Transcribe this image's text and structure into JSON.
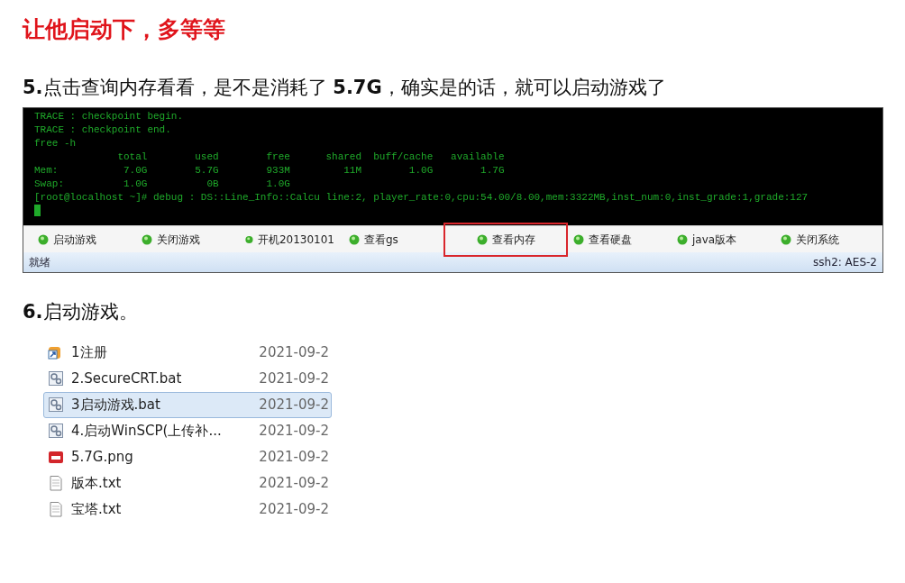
{
  "heading": "让他启动下，多等等",
  "step5": "**5.**点击查询内存看看，是不是消耗了 **5.7G**，确实是的话，就可以启动游戏了",
  "terminal": {
    "lines": [
      "TRACE : checkpoint begin.",
      "TRACE : checkpoint end.",
      "free -h",
      "              total        used        free      shared  buff/cache   available",
      "Mem:           7.0G        5.7G        933M         11M        1.0G        1.7G",
      "Swap:          1.0G          0B        1.0G",
      "[root@localhost ~]# debug : DS::Line_Info::Calcu line:2, player_rate:0,cpu:54.00/8.00,mem:3322MB,inst_num:0,inst_grade:1,grade:127"
    ],
    "buttons": [
      {
        "label": "启动游戏",
        "marked": false
      },
      {
        "label": "关闭游戏",
        "marked": false
      },
      {
        "label": "开机20130101",
        "marked": false
      },
      {
        "label": "查看gs",
        "marked": false
      },
      {
        "label": "查看内存",
        "marked": true
      },
      {
        "label": "查看硬盘",
        "marked": false
      },
      {
        "label": "java版本",
        "marked": false
      },
      {
        "label": "关闭系统",
        "marked": false
      }
    ],
    "status_left": "就绪",
    "status_right": "ssh2: AES-2"
  },
  "step6": "**6.**启动游戏。",
  "files": [
    {
      "kind": "shortcut",
      "name": "1注册",
      "date": "2021-09-2",
      "selected": false
    },
    {
      "kind": "bat",
      "name": "2.SecureCRT.bat",
      "date": "2021-09-2",
      "selected": false
    },
    {
      "kind": "bat",
      "name": "3启动游戏.bat",
      "date": "2021-09-2",
      "selected": true
    },
    {
      "kind": "bat",
      "name": "4.启动WinSCP(上传补...",
      "date": "2021-09-2",
      "selected": false
    },
    {
      "kind": "png",
      "name": "5.7G.png",
      "date": "2021-09-2",
      "selected": false
    },
    {
      "kind": "txt",
      "name": "版本.txt",
      "date": "2021-09-2",
      "selected": false
    },
    {
      "kind": "txt",
      "name": "宝塔.txt",
      "date": "2021-09-2",
      "selected": false
    }
  ]
}
